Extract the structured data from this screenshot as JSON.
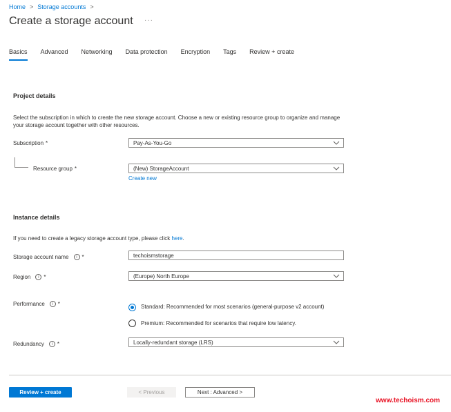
{
  "breadcrumb": {
    "home": "Home",
    "storage_accounts": "Storage accounts",
    "sep": ">"
  },
  "page": {
    "title": "Create a storage account",
    "more": "···"
  },
  "tabs": [
    {
      "label": "Basics"
    },
    {
      "label": "Advanced"
    },
    {
      "label": "Networking"
    },
    {
      "label": "Data protection"
    },
    {
      "label": "Encryption"
    },
    {
      "label": "Tags"
    },
    {
      "label": "Review + create"
    }
  ],
  "project": {
    "heading": "Project details",
    "description": "Select the subscription in which to create the new storage account. Choose a new or existing resource group to organize and manage your storage account together with other resources.",
    "subscription_label": "Subscription",
    "subscription_value": "Pay-As-You-Go",
    "resource_group_label": "Resource group",
    "resource_group_value": "(New) StorageAccount",
    "create_new": "Create new",
    "required": "*"
  },
  "instance": {
    "heading": "Instance details",
    "legacy_text": "If you need to create a legacy storage account type, please click ",
    "legacy_link": "here",
    "legacy_period": ".",
    "name_label": "Storage account name",
    "name_value": "techoismstorage",
    "region_label": "Region",
    "region_value": "(Europe) North Europe",
    "performance_label": "Performance",
    "standard_label": "Standard: Recommended for most scenarios (general-purpose v2 account)",
    "premium_label": "Premium: Recommended for scenarios that require low latency.",
    "redundancy_label": "Redundancy",
    "redundancy_value": "Locally-redundant storage (LRS)",
    "info": "i",
    "required": "*"
  },
  "footer": {
    "review_create": "Review + create",
    "previous": "< Previous",
    "next": "Next : Advanced >"
  },
  "watermark": "www.techoism.com"
}
